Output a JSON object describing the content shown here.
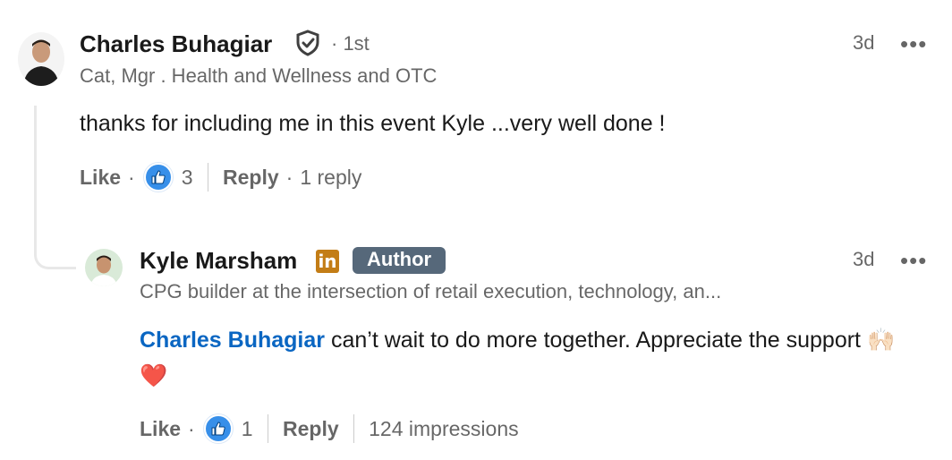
{
  "comment": {
    "author_name": "Charles Buhagiar",
    "degree": "· 1st",
    "headline": "Cat, Mgr . Health and Wellness and OTC",
    "time": "3d",
    "more_label": "•••",
    "text": "thanks for including me in this event Kyle ...very well done !",
    "like_label": "Like",
    "dot": "·",
    "like_count": "3",
    "reply_label": "Reply",
    "reply_count": "1 reply"
  },
  "reply": {
    "author_name": "Kyle Marsham",
    "linkedin_badge": "in",
    "author_badge": "Author",
    "headline": "CPG builder at the intersection of retail execution, technology, an...",
    "time": "3d",
    "more_label": "•••",
    "mention": "Charles Buhagiar",
    "text": " can’t wait to do more together. Appreciate the support ",
    "emoji": "🙌🏻❤️",
    "like_label": "Like",
    "dot": "·",
    "like_count": "1",
    "reply_label": "Reply",
    "impressions": "124 impressions"
  },
  "colors": {
    "accent": "#0a66c2",
    "like_blue": "#378fe9",
    "author_badge": "#56687a",
    "linkedin_gold": "#c37d16"
  }
}
